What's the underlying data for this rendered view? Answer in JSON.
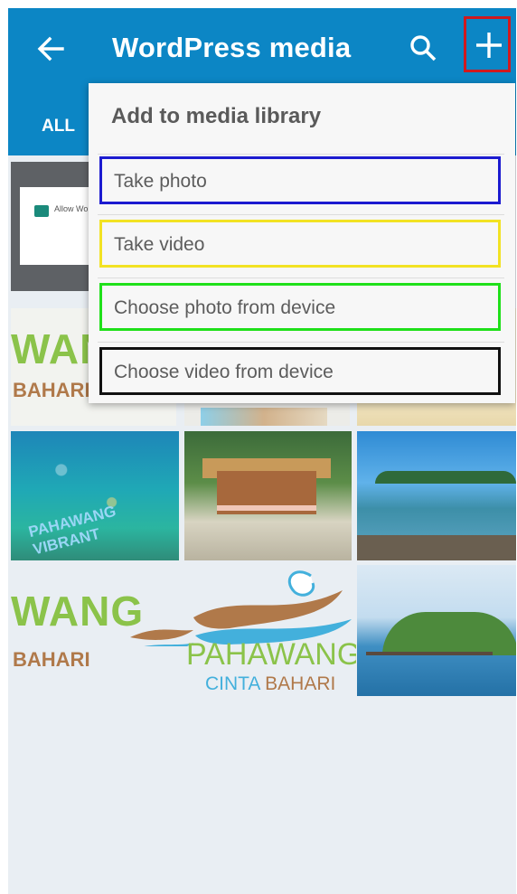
{
  "appbar": {
    "title": "WordPress media",
    "back_icon": "arrow-left-icon",
    "search_icon": "search-icon",
    "add_icon": "plus-icon",
    "background_color": "#0c86c5",
    "highlight_color": "#d0191f"
  },
  "tabs": {
    "all_label": "ALL"
  },
  "menu": {
    "title": "Add to media library",
    "items": [
      {
        "label": "Take photo",
        "outline_color": "#1c1bd0"
      },
      {
        "label": "Take video",
        "outline_color": "#f2e223"
      },
      {
        "label": "Choose photo from device",
        "outline_color": "#1fe01a"
      },
      {
        "label": "Choose video from device",
        "outline_color": "#111111"
      }
    ]
  },
  "grid": {
    "screenshot_tile": {
      "text": "Allow Wo photos, m your devi"
    },
    "logo_partial_1": {
      "wan": "WAN",
      "bahari": "BAHARI"
    },
    "underwater_tile": {
      "text": "PAHAWANG VIBRANT"
    },
    "logo_partial_2": {
      "wang": "WANG",
      "bahari": "BAHARI"
    },
    "logo_full": {
      "name": "PAHAWANG",
      "sub_1": "CINTA",
      "sub_2": "BAHARI"
    }
  }
}
